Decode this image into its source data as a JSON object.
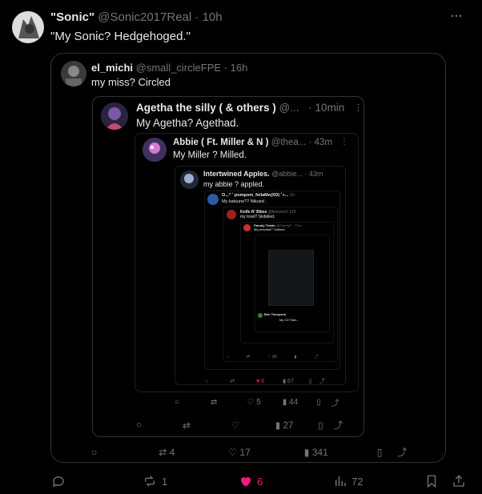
{
  "tweet": {
    "display_name": "\"Sonic\"",
    "handle": "@Sonic2017Real",
    "sep": "·",
    "time": "10h",
    "text": "\"My Sonic? Hedgehoged.\"",
    "actions": {
      "reply": "",
      "retweets": "1",
      "likes": "6",
      "views": "72"
    }
  },
  "quote1": {
    "display_name": "el_michi",
    "handle": "@small_circleFPE",
    "sep": "·",
    "time": "16h",
    "text": "my miss? Circled",
    "actions": {
      "retweets": "4",
      "likes": "17",
      "views": "341"
    }
  },
  "quote2": {
    "display_name": "Agetha the silly ( & others )",
    "handle": "@...",
    "sep": "·",
    "time": "10min",
    "text": "My Agetha? Agethad.",
    "actions": {
      "likes": "",
      "views": "27"
    }
  },
  "quote3": {
    "display_name": "Abbie ( Ft. Miller & N )",
    "handle": "@thea...",
    "sep": "·",
    "time": "43m",
    "text": "My Miller ? Milled.",
    "actions": {
      "likes": "5",
      "views": "44"
    }
  },
  "quote4": {
    "display_name": "Intertwined Apples.",
    "handle": "@abbie...",
    "sep": "·",
    "time": "43m",
    "text": "my abbie ? appled."
  },
  "quote5": {
    "display_name": "O.,.* ˚ pompom_fellaMe(XD) ˚+...",
    "time": "1h",
    "text": "My katsune?? Nikued ."
  },
  "quote6": {
    "display_name": "Knife N' Bikes",
    "handle": "@knevice2",
    "time": "12h",
    "text": "my toxel? Skibdied.",
    "actions": {
      "likes": "6",
      "views": "67"
    }
  },
  "quote7": {
    "display_name": "Parody Thinkr",
    "handle": "@ParodyT...",
    "time": "22m",
    "text": "My pencilad? Toilbred"
  },
  "quote8": {
    "display_name": "Ben Tennyson",
    "text": "My 10? Ben.."
  },
  "nested_counts": {
    "c1": "89"
  },
  "colors": {
    "bg": "#000000",
    "muted": "#71767b",
    "text": "#e7e9ea",
    "like": "#f91880",
    "border": "#2f3336"
  }
}
